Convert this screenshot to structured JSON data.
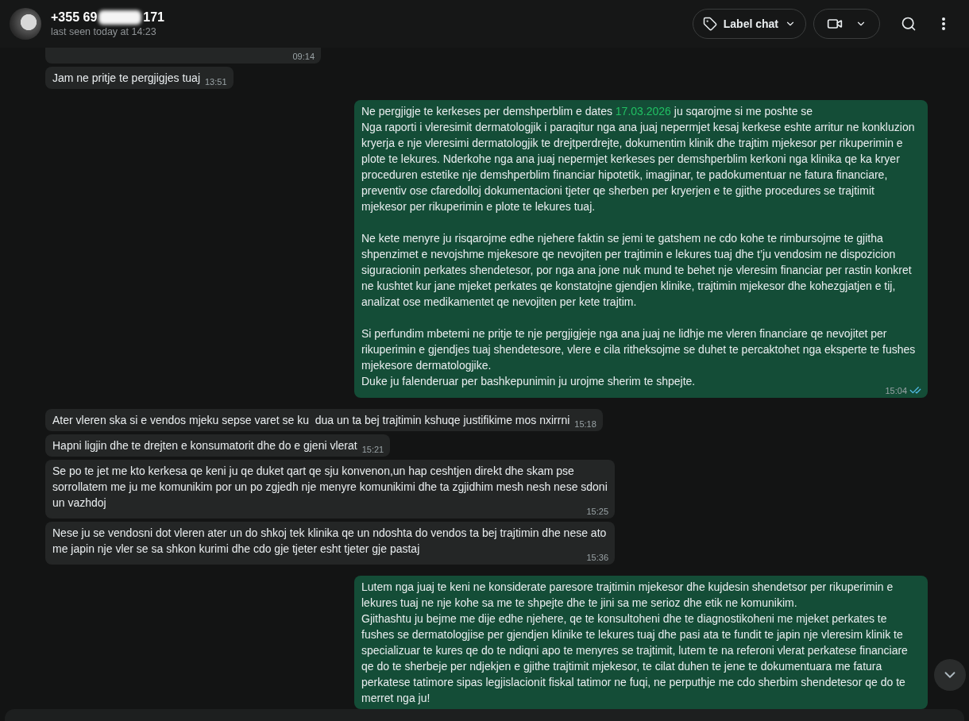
{
  "header": {
    "name_start": "+355 69",
    "name_end": "171",
    "status": "last seen today at 14:23",
    "buttons": [
      {
        "kind": "label",
        "label": "Label chat"
      },
      {
        "kind": "video"
      }
    ],
    "actions": [
      {
        "kind": "search"
      },
      {
        "kind": "menu"
      }
    ]
  },
  "messages": [
    {
      "outgoing": false,
      "time": "09:14"
    },
    {
      "outgoing": false,
      "time": "13:51",
      "parts": [
        {
          "kind": "text",
          "text": "Jam ne pritje te pergjigjes tuaj"
        }
      ]
    },
    {
      "outgoing": true,
      "time": "15:04",
      "read": true,
      "parts": [
        {
          "kind": "text",
          "text": "Ne pergjigje te kerkeses per demshperblim e dates "
        },
        {
          "kind": "date",
          "text": "17.03.2026"
        },
        {
          "kind": "text",
          "text": " ju sqarojme si me poshte se\nNga raporti i vleresimit dermatologjik i paraqitur nga ana juaj nepermjet kesaj kerkese eshte arritur ne konkluzion kryerja e nje vleresimi dermatologjik te drejtperdrejte, dokumentim klinik dhe trajtim mjekesor per rikuperimin e plote te lekures. Nderkohe nga ana juaj nepermjet kerkeses per demshperblim kerkoni nga klinika qe ka kryer proceduren estetike nje demshperblim financiar hipotetik, imagjinar, te padokumentuar ne fatura financiare, preventiv ose cfaredolloj dokumentacioni tjeter qe sherben per kryerjen e te gjithe procedures se trajtimit mjekesor per rikuperimin e plote te lekures tuaj.\n\nNe kete menyre ju risqarojme edhe njehere faktin se jemi te gatshem ne cdo kohe te rimbursojme te gjitha shpenzimet e nevojshme mjekesore qe nevojiten per trajtimin e lekures tuaj dhe t’ju vendosim ne dispozicion siguracionin perkates shendetesor, por nga ana jone nuk mund te behet nje vleresim financiar per rastin konkret ne kushtet kur jane mjeket perkates qe konstatojne gjendjen klinike, trajtimin mjekesor dhe kohezgjatjen e tij, analizat ose medikamentet qe nevojiten per kete trajtim.\n\nSi perfundim mbetemi ne pritje te nje pergjigjeje nga ana juaj ne lidhje me vleren financiare qe nevojitet per rikuperimin e gjendjes tuaj shendetesore, vlere e cila ritheksojme se duhet te percaktohet nga eksperte te fushes mjekesore dermatologjike.\nDuke ju falenderuar per bashkepunimin ju urojme sherim te shpejte."
        }
      ]
    },
    {
      "outgoing": false,
      "time": "15:18",
      "parts": [
        {
          "kind": "text",
          "text": "Ater vleren ska si e vendos mjeku sepse varet se ku  dua un ta bej trajtimin kshuqe justifikime mos nxirrni"
        }
      ]
    },
    {
      "outgoing": false,
      "time": "15:21",
      "parts": [
        {
          "kind": "text",
          "text": "Hapni ligjin dhe te drejten e konsumatorit dhe do e gjeni vlerat"
        }
      ]
    },
    {
      "outgoing": false,
      "time": "15:25",
      "parts": [
        {
          "kind": "text",
          "text": "Se po te jet me kto kerkesa qe keni ju qe duket qart qe sju konvenon,un hap ceshtjen direkt dhe skam pse sorrollatem me ju me komunikim por un po zgjedh nje menyre komunikimi dhe ta zgjidhim mesh nesh nese sdoni un vazhdoj"
        }
      ]
    },
    {
      "outgoing": false,
      "time": "15:36",
      "parts": [
        {
          "kind": "text",
          "text": "Nese ju se vendosni dot vleren ater un do shkoj tek klinika qe un ndoshta do vendos ta bej trajtimin dhe nese ato me japin nje vler se sa shkon kurimi dhe cdo gje tjeter esht tjeter gje pastaj"
        }
      ]
    },
    {
      "outgoing": true,
      "parts": [
        {
          "kind": "text",
          "text": "Lutem nga juaj te keni ne konsiderate paresore trajtimin mjekesor dhe kujdesin shendetsor per rikuperimin e lekures tuaj ne nje kohe sa me te shpejte dhe te jini sa me serioz dhe etik ne komunikim.\nGjithashtu ju bejme me dije edhe njehere, qe te konsultoheni dhe te diagnostikoheni me mjeket perkates te fushes se dermatologjise per gjendjen klinike te lekures tuaj dhe pasi ata te fundit te japin nje vleresim klinik te specializuar te kures qe do te ndiqni apo te menyres se trajtimit, lutem te na referoni vlerat perkatese financiare qe do te sherbeje per ndjekjen e gjithe trajtimit mjekesor, te cilat duhen te jene te dokumentuara me fatura perkatese tatimore sipas legjislacionit fiskal tatimor ne fuqi, ne perputhje me cdo sherbim shendetesor qe do te merret nga ju!"
        }
      ]
    }
  ]
}
